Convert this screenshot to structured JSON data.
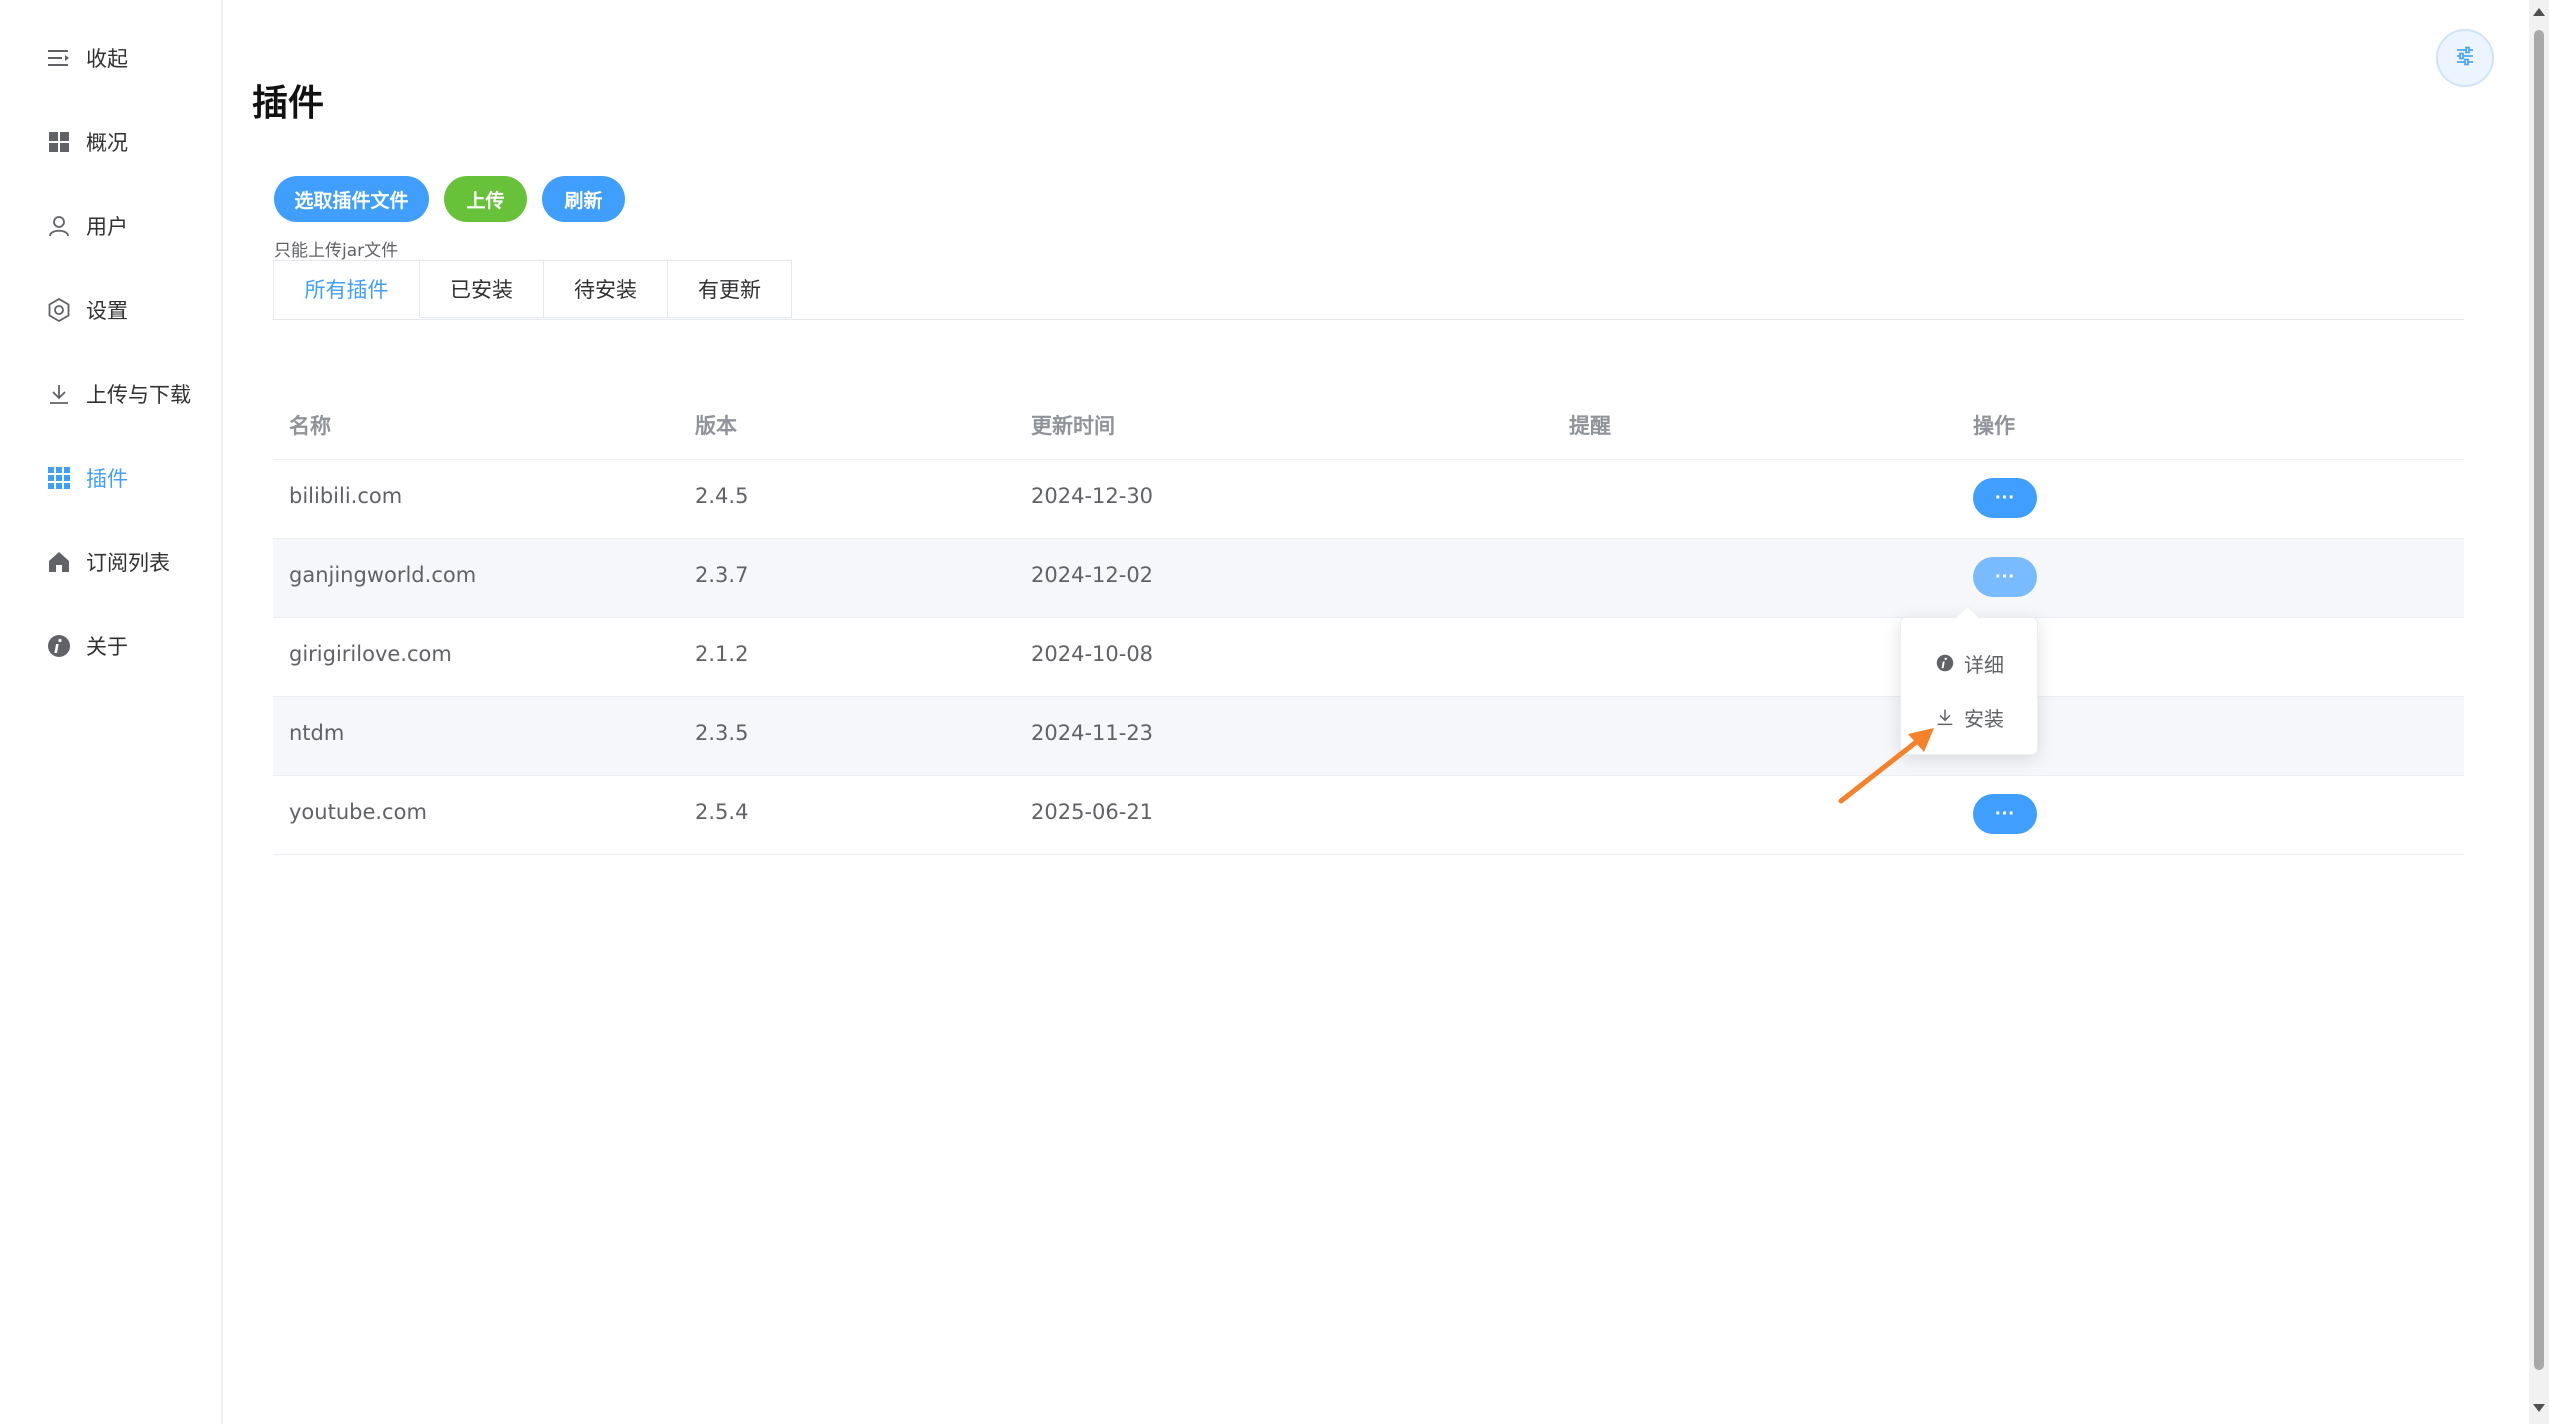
{
  "sidebar": {
    "items": [
      {
        "label": "收起",
        "icon": "collapse-icon"
      },
      {
        "label": "概况",
        "icon": "dashboard-icon"
      },
      {
        "label": "用户",
        "icon": "user-icon"
      },
      {
        "label": "设置",
        "icon": "gear-icon"
      },
      {
        "label": "上传与下载",
        "icon": "download-icon"
      },
      {
        "label": "插件",
        "icon": "grid-icon",
        "active": true
      },
      {
        "label": "订阅列表",
        "icon": "home-icon"
      },
      {
        "label": "关于",
        "icon": "info-icon"
      }
    ]
  },
  "page": {
    "title": "插件"
  },
  "toolbar": {
    "select_label": "选取插件文件",
    "upload_label": "上传",
    "refresh_label": "刷新",
    "tip": "只能上传jar文件"
  },
  "tabs": [
    {
      "label": "所有插件",
      "active": true
    },
    {
      "label": "已安装"
    },
    {
      "label": "待安装"
    },
    {
      "label": "有更新"
    }
  ],
  "table": {
    "headers": {
      "name": "名称",
      "version": "版本",
      "updated": "更新时间",
      "note": "提醒",
      "ops": "操作"
    },
    "rows": [
      {
        "name": "bilibili.com",
        "version": "2.4.5",
        "updated": "2024-12-30",
        "note": ""
      },
      {
        "name": "ganjingworld.com",
        "version": "2.3.7",
        "updated": "2024-12-02",
        "note": ""
      },
      {
        "name": "girigirilove.com",
        "version": "2.1.2",
        "updated": "2024-10-08",
        "note": ""
      },
      {
        "name": "ntdm",
        "version": "2.3.5",
        "updated": "2024-11-23",
        "note": ""
      },
      {
        "name": "youtube.com",
        "version": "2.5.4",
        "updated": "2025-06-21",
        "note": ""
      }
    ],
    "more_label": "···"
  },
  "dropdown": {
    "items": [
      {
        "label": "详细",
        "icon": "info-icon"
      },
      {
        "label": "安装",
        "icon": "download-icon"
      }
    ]
  },
  "colors": {
    "accent": "#409eff",
    "success": "#67c23a",
    "annotation": "#f5822a"
  }
}
